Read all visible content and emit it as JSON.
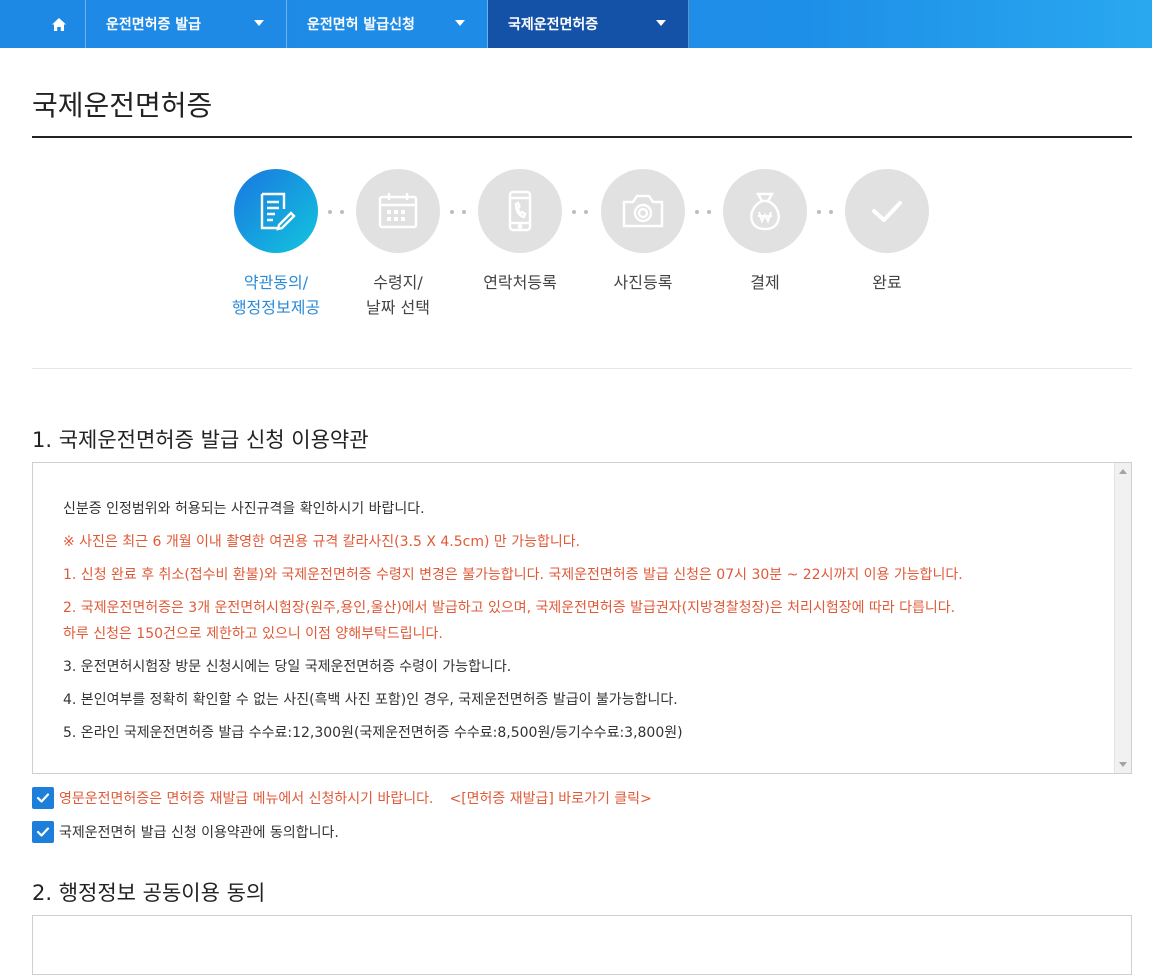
{
  "nav": {
    "items": [
      {
        "label": "운전면허증 발급"
      },
      {
        "label": "운전면허 발급신청"
      },
      {
        "label": "국제운전면허증"
      }
    ]
  },
  "page": {
    "title": "국제운전면허증"
  },
  "steps": [
    {
      "line1": "약관동의/",
      "line2": "행정정보제공",
      "icon": "document-icon"
    },
    {
      "line1": "수령지/",
      "line2": "날짜 선택",
      "icon": "calendar-icon"
    },
    {
      "line1": "연락처등록",
      "line2": "",
      "icon": "phone-icon"
    },
    {
      "line1": "사진등록",
      "line2": "",
      "icon": "camera-icon"
    },
    {
      "line1": "결제",
      "line2": "",
      "icon": "money-bag-icon"
    },
    {
      "line1": "완료",
      "line2": "",
      "icon": "checkmark-icon"
    }
  ],
  "section1": {
    "title": "1. 국제운전면허증 발급 신청 이용약관",
    "lines": [
      "신분증 인정범위와 허용되는 사진규격을 확인하시기 바랍니다.",
      "※ 사진은 최근 6 개월 이내 촬영한 여권용 규격 칼라사진(3.5 X 4.5cm) 만 가능합니다.",
      "1. 신청 완료 후 취소(접수비 환불)와 국제운전면허증 수령지 변경은 불가능합니다. 국제운전면허증 발급 신청은 07시 30분 ~ 22시까지 이용 가능합니다.",
      "2. 국제운전면허증은 3개 운전면허시험장(원주,용인,울산)에서 발급하고 있으며, 국제운전면허증 발급권자(지방경찰청장)은 처리시험장에 따라 다릅니다.",
      "하루 신청은 150건으로 제한하고 있으니 이점 양해부탁드립니다.",
      "3. 운전면허시험장 방문 신청시에는 당일 국제운전면허증 수령이 가능합니다.",
      "4. 본인여부를 정확히 확인할 수 없는 사진(흑백 사진 포함)인 경우, 국제운전면허증 발급이 불가능합니다.",
      "5. 온라인 국제운전면허증 발급 수수료:12,300원(국제운전면허증 수수료:8,500원/등기수수료:3,800원)"
    ]
  },
  "checks": {
    "english_notice": "영문운전면허증은 면허증 재발급 메뉴에서 신청하시기 바랍니다.",
    "english_link": "<[면허증 재발급] 바로가기 클릭>",
    "agree_terms": "국제운전면허 발급 신청 이용약관에 동의합니다."
  },
  "section2": {
    "title": "2. 행정정보 공동이용 동의"
  },
  "colors": {
    "accent": "#1e88e5",
    "active_nav": "#1452a8",
    "notice_red": "#e05a38",
    "step_active": "#2a8ad8"
  }
}
